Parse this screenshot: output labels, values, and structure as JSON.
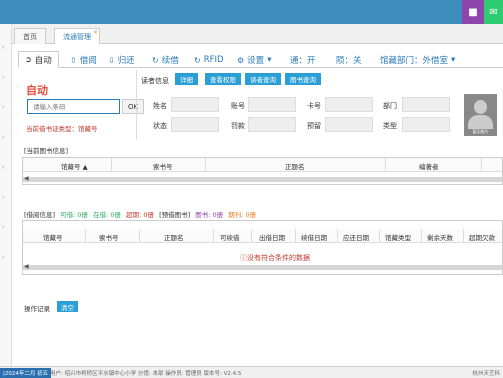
{
  "tabs": [
    {
      "label": "首页"
    },
    {
      "label": "流通管理"
    }
  ],
  "toolbar": {
    "auto": "自动",
    "borrow": "借阅",
    "return": "归还",
    "renew": "续借",
    "rfid": "RFID",
    "settings": "设置",
    "through": "通：开",
    "off": "陨：关",
    "dept": "馆藏部门：外借室"
  },
  "auto_panel": {
    "title": "自动",
    "input_placeholder": "请输入条码",
    "ok": "OK",
    "card_type": "当前借书证类型：馆藏号"
  },
  "reader": {
    "label": "读者信息",
    "buttons": [
      "详细",
      "查看权限",
      "读者查询",
      "图书查询"
    ],
    "fields": {
      "name": "姓名",
      "account": "账号",
      "card": "卡号",
      "dept": "部门",
      "status": "状态",
      "fine": "罚款",
      "lost": "预留",
      "type": "类型"
    },
    "photo_text": "暂无照片"
  },
  "current_books": {
    "title": "[当前图书信息]",
    "columns": [
      "馆藏号",
      "索书号",
      "正题名",
      "编著者"
    ]
  },
  "borrow_info": {
    "title": "[借阅信息]",
    "stats": [
      {
        "text": "可借: 0册",
        "color": "#27ae60"
      },
      {
        "text": "在借: 0册",
        "color": "#27ae60"
      },
      {
        "text": "超期: 0册",
        "color": "#c0392b"
      },
      {
        "text": "[预借图书]",
        "color": "#333333"
      },
      {
        "text": "图书: 0册",
        "color": "#8e44ad"
      },
      {
        "text": "期刊: 0册",
        "color": "#e67e22"
      }
    ],
    "columns": [
      "馆藏号",
      "索书号",
      "正题名",
      "可续借",
      "出借日期",
      "续借日期",
      "应还日期",
      "馆藏类型",
      "剩余天数",
      "超期欠款"
    ],
    "empty": "没有符合条件的数据"
  },
  "log": {
    "label": "操作记录",
    "clear": "清空"
  },
  "footer": {
    "date": "|2024年二月 初五",
    "text": "用户: 绍兴市柯桥区平水镇中心小学 分馆: 本部 操作员: 管理员 版本号: V2.4.5",
    "right": "杭州天艺科"
  }
}
